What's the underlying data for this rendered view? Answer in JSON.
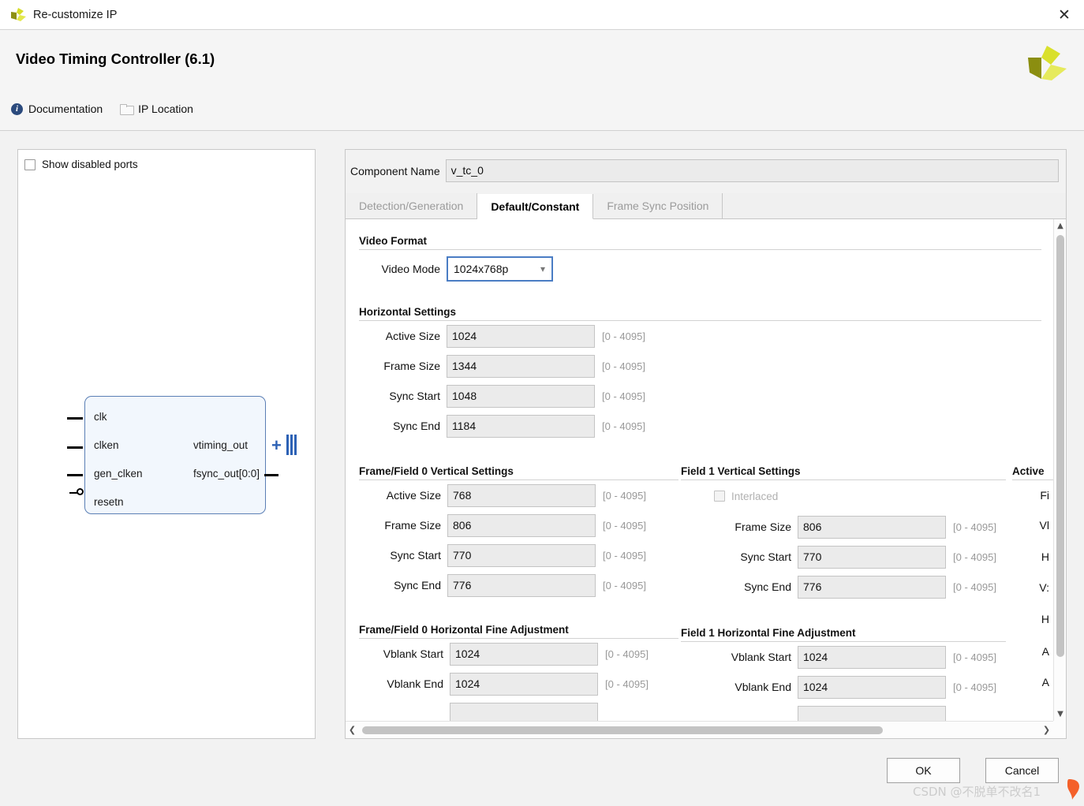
{
  "window": {
    "title": "Re-customize IP",
    "close_label": "✕",
    "logo_name": "xilinx-logo"
  },
  "header": {
    "ip_title": "Video Timing Controller (6.1)",
    "links": [
      {
        "label": "Documentation",
        "icon": "info-icon"
      },
      {
        "label": "IP Location",
        "icon": "folder-icon"
      }
    ]
  },
  "left_panel": {
    "show_disabled_ports": {
      "label": "Show disabled ports",
      "checked": false
    },
    "symbol": {
      "inputs": [
        "clk",
        "clken",
        "gen_clken",
        "resetn"
      ],
      "outputs": [
        "vtiming_out",
        "fsync_out[0:0]"
      ]
    }
  },
  "component": {
    "label": "Component Name",
    "value": "v_tc_0"
  },
  "tabs": [
    {
      "label": "Detection/Generation",
      "active": false
    },
    {
      "label": "Default/Constant",
      "active": true
    },
    {
      "label": "Frame Sync Position",
      "active": false
    }
  ],
  "range_hint": "[0 - 4095]",
  "sections": {
    "video_format": {
      "title": "Video Format",
      "video_mode": {
        "label": "Video Mode",
        "value": "1024x768p",
        "caret": "⌄"
      }
    },
    "horizontal": {
      "title": "Horizontal Settings",
      "fields": [
        {
          "label": "Active Size",
          "value": "1024",
          "range": "[0 - 4095]"
        },
        {
          "label": "Frame Size",
          "value": "1344",
          "range": "[0 - 4095]"
        },
        {
          "label": "Sync Start",
          "value": "1048",
          "range": "[0 - 4095]"
        },
        {
          "label": "Sync End",
          "value": "1184",
          "range": "[0 - 4095]"
        }
      ]
    },
    "field0_vertical": {
      "title": "Frame/Field 0 Vertical Settings",
      "fields": [
        {
          "label": "Active Size",
          "value": "768",
          "range": "[0 - 4095]"
        },
        {
          "label": "Frame Size",
          "value": "806",
          "range": "[0 - 4095]"
        },
        {
          "label": "Sync Start",
          "value": "770",
          "range": "[0 - 4095]"
        },
        {
          "label": "Sync End",
          "value": "776",
          "range": "[0 - 4095]"
        }
      ]
    },
    "field1_vertical": {
      "title": "Field 1 Vertical Settings",
      "interlaced": {
        "label": "Interlaced",
        "checked": false,
        "disabled": true
      },
      "fields": [
        {
          "label": "Frame Size",
          "value": "806",
          "range": "[0 - 4095]"
        },
        {
          "label": "Sync Start",
          "value": "770",
          "range": "[0 - 4095]"
        },
        {
          "label": "Sync End",
          "value": "776",
          "range": "[0 - 4095]"
        }
      ]
    },
    "field0_hfine": {
      "title": "Frame/Field 0 Horizontal Fine Adjustment",
      "fields": [
        {
          "label": "Vblank Start",
          "value": "1024",
          "range": "[0 - 4095]"
        },
        {
          "label": "Vblank End",
          "value": "1024",
          "range": "[0 - 4095]"
        }
      ]
    },
    "field1_hfine": {
      "title": "Field 1 Horizontal Fine Adjustment",
      "fields": [
        {
          "label": "Vblank Start",
          "value": "1024",
          "range": "[0 - 4095]"
        },
        {
          "label": "Vblank End",
          "value": "1024",
          "range": "[0 - 4095]"
        }
      ]
    },
    "clipped_column": {
      "title": "Active",
      "labels": [
        "Fi",
        "Vl",
        "H",
        "V:",
        "H",
        "A",
        "A"
      ]
    }
  },
  "footer": {
    "ok_label": "OK",
    "cancel_label": "Cancel"
  },
  "watermark": {
    "text": "CSDN @不脱单不改名1"
  }
}
